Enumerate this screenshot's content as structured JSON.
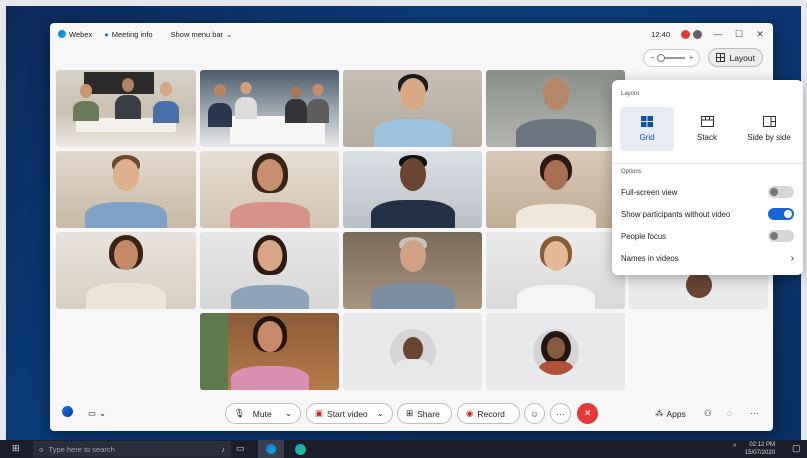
{
  "titlebar": {
    "app_name": "Webex",
    "meeting_info": "Meeting info",
    "show_menu_bar": "Show menu bar",
    "time": "12:40"
  },
  "top_toolbar": {
    "zoom_out": "−",
    "zoom_in": "+",
    "layout_label": "Layout"
  },
  "layout_panel": {
    "section_layout": "Layout",
    "options": [
      {
        "label": "Grid",
        "icon": "grid-icon",
        "active": true
      },
      {
        "label": "Stack",
        "icon": "stack-icon",
        "active": false
      },
      {
        "label": "Side by side",
        "icon": "side-by-side-icon",
        "active": false
      }
    ],
    "section_options": "Options",
    "settings": [
      {
        "label": "Full-screen view",
        "on": false
      },
      {
        "label": "Show participants without video",
        "on": true
      },
      {
        "label": "People focus",
        "on": false
      }
    ],
    "names_in_videos": "Names in videos"
  },
  "bottom_bar": {
    "mute": "Mute",
    "start_video": "Start video",
    "share": "Share",
    "record": "Record",
    "apps": "Apps"
  },
  "taskbar": {
    "search_placeholder": "Type here to search",
    "time": "02:12 PM",
    "date": "15/07/2020"
  }
}
